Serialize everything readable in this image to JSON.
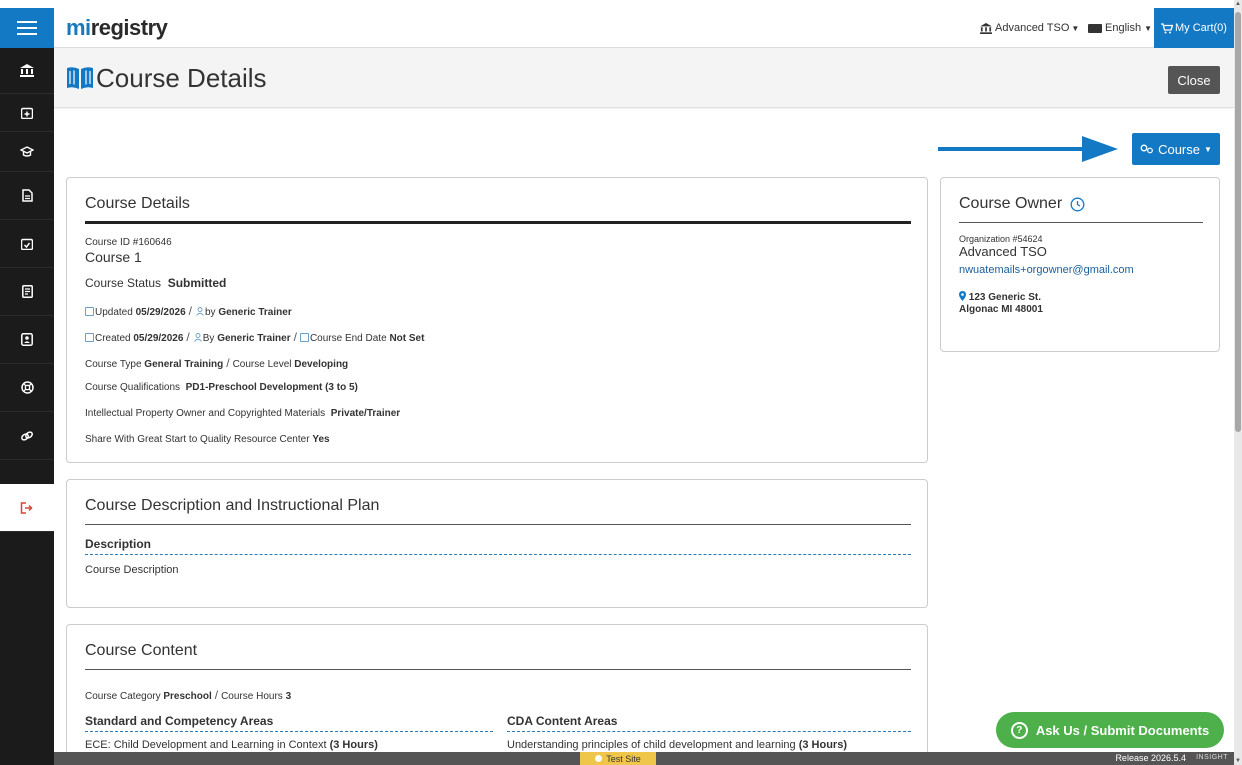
{
  "app": {
    "logo_mi": "mi",
    "logo_registry": "registry"
  },
  "header": {
    "org_label": "Advanced TSO",
    "language_label": "English",
    "cart_label": "My Cart(0)"
  },
  "page": {
    "title": "Course Details",
    "close_label": "Close",
    "course_button_label": "Course"
  },
  "course_details": {
    "heading": "Course Details",
    "course_id": "Course ID #160646",
    "course_name": "Course 1",
    "status_label": "Course Status",
    "status_value": "Submitted",
    "updated_label": "Updated",
    "updated_date": "05/29/2026",
    "updated_by_label": "by",
    "updated_by": "Generic Trainer",
    "created_label": "Created",
    "created_date": "05/29/2026",
    "created_by_label": "By",
    "created_by": "Generic Trainer",
    "end_date_label": "Course End Date",
    "end_date_value": "Not Set",
    "type_label": "Course Type",
    "type_value": "General Training",
    "level_label": "Course Level",
    "level_value": "Developing",
    "qualifications_label": "Course Qualifications",
    "qualifications_value": "PD1-Preschool Development (3 to 5)",
    "ip_label": "Intellectual Property Owner and Copyrighted Materials",
    "ip_value": "Private/Trainer",
    "share_label": "Share With Great Start to Quality Resource Center",
    "share_value": "Yes"
  },
  "course_owner": {
    "heading": "Course Owner",
    "org_id": "Organization #54624",
    "org_name": "Advanced TSO",
    "email": "nwuatemails+orgowner@gmail.com",
    "address_line1": "123 Generic St.",
    "address_line2": "Algonac MI 48001"
  },
  "description_card": {
    "heading": "Course Description and Instructional Plan",
    "description_label": "Description",
    "description_value": "Course Description"
  },
  "content_card": {
    "heading": "Course Content",
    "category_label": "Course Category",
    "category_value": "Preschool",
    "hours_label": "Course Hours",
    "hours_value": "3",
    "standard_heading": "Standard and Competency Areas",
    "standard_item": "ECE: Child Development and Learning in Context",
    "standard_hours": "(3 Hours)",
    "cda_heading": "CDA Content Areas",
    "cda_item": "Understanding principles of child development and learning",
    "cda_hours": "(3 Hours)"
  },
  "footer": {
    "test_site_label": "Test Site",
    "release_label": "Release 2026.5.4",
    "insight_label": "INSIGHT",
    "ask_label": "Ask Us / Submit Documents"
  },
  "colors": {
    "primary_blue": "#1479c4",
    "sidebar_dark": "#1b1b1b",
    "ask_green": "#4db04a",
    "test_yellow": "#f0c64a",
    "logout_red": "#d9453b"
  }
}
